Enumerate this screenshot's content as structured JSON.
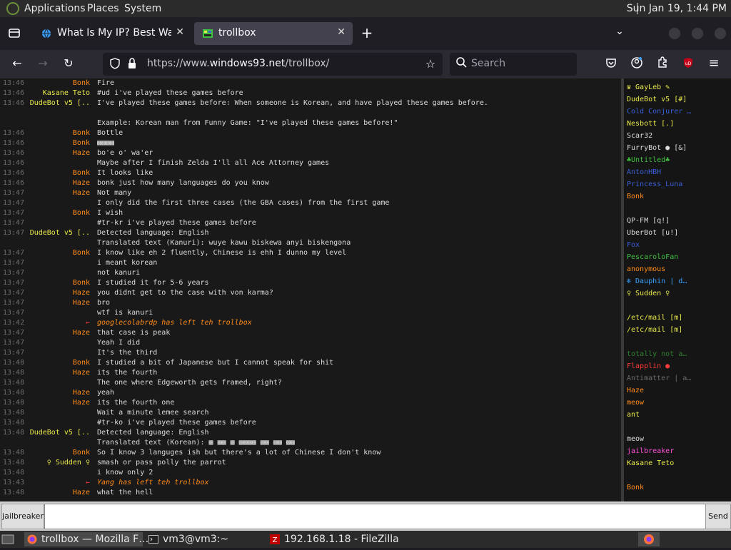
{
  "topbar": {
    "menus": [
      "Applications",
      "Places",
      "System"
    ],
    "clock": "Sun Jan 19, 1:44 PM"
  },
  "tabs": [
    {
      "title": "What Is My IP? Best Way To",
      "active": false
    },
    {
      "title": "trollbox",
      "active": true
    }
  ],
  "navbar": {
    "url_prefix": "https://www.",
    "url_host": "windows93.net",
    "url_path": "/trollbox/",
    "search_placeholder": "Search"
  },
  "colors": {
    "orange": "#ff8c1a",
    "blue": "#3a5fd6",
    "yellow": "#e8e84a",
    "green": "#3fbf3f",
    "red": "#ff3b3b",
    "white": "#dcdcdc",
    "pink": "#ff4fd8",
    "cyan": "#3aa0ff"
  },
  "messages": [
    {
      "time": "13:46",
      "nick": "Bonk",
      "color": "#ff8c1a",
      "text": "Fire"
    },
    {
      "time": "13:46",
      "nick": "Kasane Teto",
      "color": "#e8e84a",
      "text": "#ud i've played these games before"
    },
    {
      "time": "13:46",
      "nick": "DudeBot v5 [..",
      "color": "#e8e84a",
      "text": "I've played these games before: When someone is Korean, and have played these games before."
    },
    {
      "time": "",
      "nick": "",
      "color": "#dcdcdc",
      "text": ""
    },
    {
      "time": "",
      "nick": "",
      "color": "#dcdcdc",
      "text": "Example: Korean man from Funny Game: \"I've played these games before!\""
    },
    {
      "time": "13:46",
      "nick": "Bonk",
      "color": "#ff8c1a",
      "text": "Bottle"
    },
    {
      "time": "13:46",
      "nick": "Bonk",
      "color": "#ff8c1a",
      "text": "▩▩▩▩"
    },
    {
      "time": "13:46",
      "nick": "Haze",
      "color": "#ff8c1a",
      "text": "bo'e o' wa'er"
    },
    {
      "time": "13:46",
      "nick": "",
      "color": "#3a5fd6",
      "text": "Maybe after I finish Zelda I'll all Ace Attorney games"
    },
    {
      "time": "13:46",
      "nick": "Bonk",
      "color": "#ff8c1a",
      "text": "It looks like"
    },
    {
      "time": "13:46",
      "nick": "Haze",
      "color": "#ff8c1a",
      "text": "bonk just how many languages do you know"
    },
    {
      "time": "13:47",
      "nick": "Haze",
      "color": "#ff8c1a",
      "text": "Not many"
    },
    {
      "time": "13:47",
      "nick": "",
      "color": "#3a5fd6",
      "text": "I only did the first three cases (the GBA cases) from the first game"
    },
    {
      "time": "13:47",
      "nick": "Bonk",
      "color": "#ff8c1a",
      "text": "I wish"
    },
    {
      "time": "13:47",
      "nick": "",
      "color": "#3a5fd6",
      "text": "#tr-kr i've played these games before"
    },
    {
      "time": "13:47",
      "nick": "DudeBot v5 [..",
      "color": "#e8e84a",
      "text": "Detected language: English"
    },
    {
      "time": "",
      "nick": "",
      "color": "#dcdcdc",
      "text": "Translated text (Kanuri): wuye kawu biskewa anyi biskengəna"
    },
    {
      "time": "13:47",
      "nick": "Bonk",
      "color": "#ff8c1a",
      "text": "I know like eh 2 fluently, Chinese is ehh I dunno my level"
    },
    {
      "time": "13:47",
      "nick": "",
      "color": "#3a5fd6",
      "text": "i meant korean"
    },
    {
      "time": "13:47",
      "nick": "",
      "color": "#3a5fd6",
      "text": "not kanuri"
    },
    {
      "time": "13:47",
      "nick": "Bonk",
      "color": "#ff8c1a",
      "text": "I studied it for 5-6 years"
    },
    {
      "time": "13:47",
      "nick": "Haze",
      "color": "#ff8c1a",
      "text": "you didnt get to the case with von karma?"
    },
    {
      "time": "13:47",
      "nick": "Haze",
      "color": "#ff8c1a",
      "text": "bro"
    },
    {
      "time": "13:47",
      "nick": "",
      "color": "#3a5fd6",
      "text": "wtf is kanuri"
    },
    {
      "time": "13:42",
      "nick": "←",
      "color": "#ff3b3b",
      "text": "googlecolabrdp has left teh trollbox",
      "system": true
    },
    {
      "time": "13:47",
      "nick": "Haze",
      "color": "#ff8c1a",
      "text": "that case is peak"
    },
    {
      "time": "13:47",
      "nick": "",
      "color": "#3a5fd6",
      "text": "Yeah I did"
    },
    {
      "time": "13:47",
      "nick": "",
      "color": "#3a5fd6",
      "text": "It's the third"
    },
    {
      "time": "13:48",
      "nick": "Bonk",
      "color": "#ff8c1a",
      "text": "I studied a bit of Japanese but I cannot speak for shit"
    },
    {
      "time": "13:48",
      "nick": "Haze",
      "color": "#ff8c1a",
      "text": "its the fourth"
    },
    {
      "time": "13:48",
      "nick": "",
      "color": "#3a5fd6",
      "text": "The one where Edgeworth gets framed, right?"
    },
    {
      "time": "13:48",
      "nick": "Haze",
      "color": "#ff8c1a",
      "text": "yeah"
    },
    {
      "time": "13:48",
      "nick": "Haze",
      "color": "#ff8c1a",
      "text": "its the fourth one"
    },
    {
      "time": "13:48",
      "nick": "",
      "color": "#3a5fd6",
      "text": "Wait a minute lemee search"
    },
    {
      "time": "13:48",
      "nick": "",
      "color": "#3a5fd6",
      "text": "#tr-ko i've played these games before"
    },
    {
      "time": "13:48",
      "nick": "DudeBot v5 [..",
      "color": "#e8e84a",
      "text": "Detected language: English"
    },
    {
      "time": "",
      "nick": "",
      "color": "#dcdcdc",
      "text": "Translated text (Korean): ▩ ▩▩ ▩ ▩▩▩▩ ▩▩ ▩▩ ▩▩"
    },
    {
      "time": "13:48",
      "nick": "Bonk",
      "color": "#ff8c1a",
      "text": "So I know 3 languges ish but there's a lot of Chinese I don't know"
    },
    {
      "time": "13:48",
      "nick": "♀ Sudden ♀",
      "color": "#e8e84a",
      "text": "smash or pass polly the parrot"
    },
    {
      "time": "13:48",
      "nick": "",
      "color": "#3a5fd6",
      "text": "i know only 2"
    },
    {
      "time": "13:43",
      "nick": "←",
      "color": "#ff3b3b",
      "text": "Yang has left teh trollbox",
      "system": true,
      "lead": "Yang"
    },
    {
      "time": "13:48",
      "nick": "Haze",
      "color": "#ff8c1a",
      "text": "what the hell"
    }
  ],
  "users": [
    {
      "name": "♛ GayLeb ✎",
      "color": "#e8e84a"
    },
    {
      "name": "DudeBot v5 [#]",
      "color": "#e8e84a"
    },
    {
      "name": "Cold Conjurer …",
      "color": "#3a5fd6"
    },
    {
      "name": "Nesbott [.]",
      "color": "#e8e84a"
    },
    {
      "name": "Scar32",
      "color": "#dcdcdc"
    },
    {
      "name": "FurryBot ● [&]",
      "color": "#dcdcdc"
    },
    {
      "name": "♣Untitled♣",
      "color": "#3fbf3f"
    },
    {
      "name": "AntonHBH",
      "color": "#3a5fd6"
    },
    {
      "name": "Princess_Luna",
      "color": "#3a5fd6"
    },
    {
      "name": "Bonk",
      "color": "#ff8c1a"
    },
    {
      "name": "",
      "color": "#3fbf3f"
    },
    {
      "name": "QP-FM [q!]",
      "color": "#dcdcdc"
    },
    {
      "name": "UberBot [u!]",
      "color": "#dcdcdc"
    },
    {
      "name": "Fox",
      "color": "#3a5fd6"
    },
    {
      "name": "PescaroloFan",
      "color": "#3fbf3f"
    },
    {
      "name": "anonymous",
      "color": "#ff8c1a"
    },
    {
      "name": "❄ Dauphin | d…",
      "color": "#3aa0ff"
    },
    {
      "name": "♀ Sudden ♀",
      "color": "#e8e84a"
    },
    {
      "name": "",
      "color": "#3a5fd6"
    },
    {
      "name": "/etc/mail [m]",
      "color": "#e8e84a"
    },
    {
      "name": "/etc/mail [m]",
      "color": "#e8e84a"
    },
    {
      "name": "",
      "color": "#3a5fd6"
    },
    {
      "name": "totally not a…",
      "color": "#2f7f2f"
    },
    {
      "name": "Flapplin ●",
      "color": "#ff3b3b"
    },
    {
      "name": "Antimatter | a…",
      "color": "#6b6b6b"
    },
    {
      "name": "Haze",
      "color": "#ff8c1a"
    },
    {
      "name": "meow",
      "color": "#ff8c1a"
    },
    {
      "name": "ant",
      "color": "#e8e84a"
    },
    {
      "name": "",
      "color": "#3a5fd6"
    },
    {
      "name": "meow",
      "color": "#dcdcdc"
    },
    {
      "name": "jailbreaker",
      "color": "#ff4fd8"
    },
    {
      "name": "Kasane Teto",
      "color": "#e8e84a"
    },
    {
      "name": "",
      "color": "#3a5fd6"
    },
    {
      "name": "Bonk",
      "color": "#ff8c1a"
    }
  ],
  "input": {
    "nick": "jailbreaker",
    "value": "",
    "send_label": "Send"
  },
  "taskbar": [
    {
      "label": "trollbox — Mozilla F…"
    },
    {
      "label": "vm3@vm3:~"
    },
    {
      "label": "192.168.1.18 - FileZilla"
    }
  ]
}
